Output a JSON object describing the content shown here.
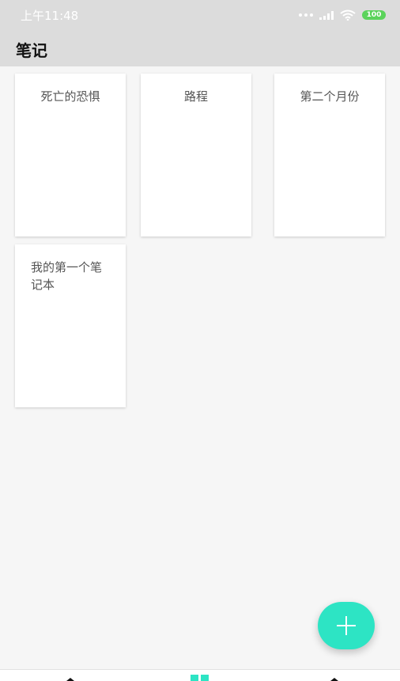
{
  "status_bar": {
    "time": "上午11:48",
    "battery": "100"
  },
  "toolbar": {
    "title": "笔记"
  },
  "notebooks": [
    {
      "title": "死亡的恐惧"
    },
    {
      "title": "路程"
    },
    {
      "title": "第二个月份"
    },
    {
      "title": "我的第一个笔记本"
    }
  ],
  "fab": {
    "icon": "plus-icon"
  },
  "bottom_nav": {
    "items": [
      {
        "icon": "home-icon"
      },
      {
        "icon": "grid-icon",
        "active": true
      },
      {
        "icon": "profile-icon"
      }
    ]
  },
  "colors": {
    "accent": "#2de4c4",
    "toolbar": "#dcdcdc",
    "background": "#f6f6f6",
    "battery": "#5bd35b"
  }
}
